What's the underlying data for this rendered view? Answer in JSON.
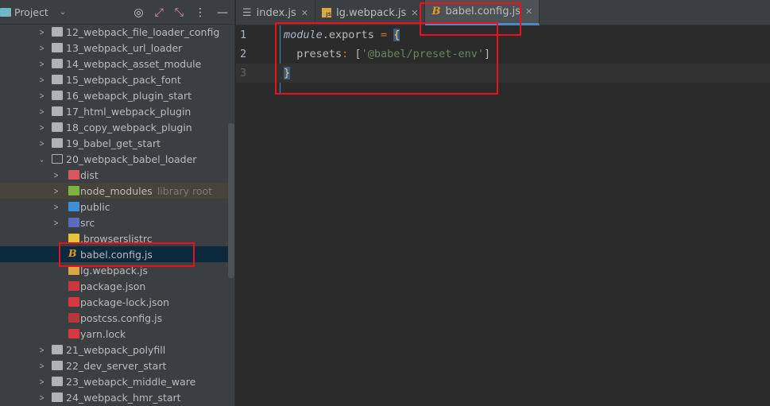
{
  "sidebar": {
    "title": "Project",
    "tree": [
      {
        "label": "12_webpack_file_loader_config",
        "type": "folder",
        "level": 1
      },
      {
        "label": "13_webpack_url_loader",
        "type": "folder",
        "level": 1
      },
      {
        "label": "14_webpack_asset_module",
        "type": "folder",
        "level": 1
      },
      {
        "label": "15_webpack_pack_font",
        "type": "folder",
        "level": 1
      },
      {
        "label": "16_webapck_plugin_start",
        "type": "folder",
        "level": 1
      },
      {
        "label": "17_html_webpack_plugin",
        "type": "folder",
        "level": 1
      },
      {
        "label": "18_copy_webpack_plugin",
        "type": "folder",
        "level": 1
      },
      {
        "label": "19_babel_get_start",
        "type": "folder",
        "level": 1
      },
      {
        "label": "20_webpack_babel_loader",
        "type": "folder-open",
        "level": 1
      },
      {
        "label": "dist",
        "type": "dist",
        "level": 2
      },
      {
        "label": "node_modules",
        "type": "node",
        "level": 2,
        "suffix": "library root"
      },
      {
        "label": "public",
        "type": "public",
        "level": 2
      },
      {
        "label": "src",
        "type": "src",
        "level": 2
      },
      {
        "label": ".browserslistrc",
        "type": "browsers",
        "level": 2
      },
      {
        "label": "babel.config.js",
        "type": "babel",
        "level": 2,
        "selected": true
      },
      {
        "label": "lg.webpack.js",
        "type": "js",
        "level": 2
      },
      {
        "label": "package.json",
        "type": "npm",
        "level": 2
      },
      {
        "label": "package-lock.json",
        "type": "lock",
        "level": 2
      },
      {
        "label": "postcss.config.js",
        "type": "postcss",
        "level": 2
      },
      {
        "label": "yarn.lock",
        "type": "lock",
        "level": 2
      },
      {
        "label": "21_webpack_polyfill",
        "type": "folder",
        "level": 1
      },
      {
        "label": "22_dev_server_start",
        "type": "folder",
        "level": 1
      },
      {
        "label": "23_webapck_middle_ware",
        "type": "folder",
        "level": 1
      },
      {
        "label": "24_webpack_hmr_start",
        "type": "folder",
        "level": 1
      }
    ]
  },
  "tabs": [
    {
      "label": "index.js",
      "icon": "list-icon"
    },
    {
      "label": "lg.webpack.js",
      "icon": "js-icon"
    },
    {
      "label": "babel.config.js",
      "icon": "babel-icon",
      "active": true
    }
  ],
  "editor": {
    "lines": [
      {
        "num": "1",
        "parts": [
          [
            "kw",
            "module"
          ],
          [
            "",
            "."
          ],
          [
            "",
            "exports "
          ],
          [
            "op",
            "= "
          ],
          [
            "brace",
            "{"
          ]
        ]
      },
      {
        "num": "2",
        "parts": [
          [
            "",
            "  presets"
          ],
          [
            "op",
            ": "
          ],
          [
            "",
            "["
          ],
          [
            "str",
            "'@babel/preset-env'"
          ],
          [
            "",
            "]"
          ]
        ]
      },
      {
        "num": "3",
        "parts": [
          [
            "brace",
            "}"
          ]
        ]
      }
    ]
  },
  "colors": {
    "highlight": "#e8121c",
    "accent": "#4a88c7"
  }
}
